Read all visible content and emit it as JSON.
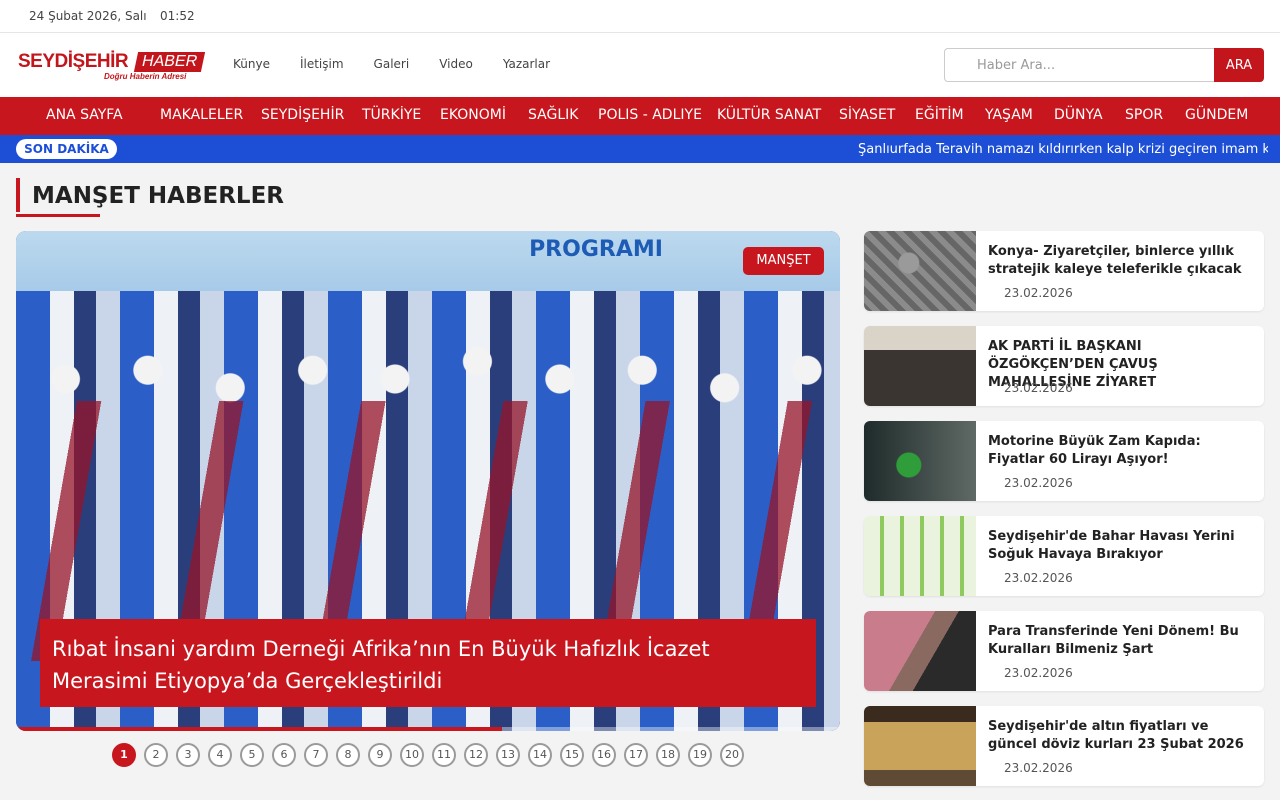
{
  "topbar": {
    "date": "24 Şubat 2026, Salı",
    "time": "01:52"
  },
  "logo": {
    "name": "SEYDİŞEHİR",
    "tag": "HABER",
    "slogan": "Doğru Haberin Adresi"
  },
  "topnav": [
    "Künye",
    "İletişim",
    "Galeri",
    "Video",
    "Yazarlar"
  ],
  "search": {
    "placeholder": "Haber Ara...",
    "button": "ARA"
  },
  "mainnav": [
    "ANA SAYFA",
    "MAKALELER",
    "SEYDİŞEHİR",
    "TÜRKİYE",
    "EKONOMİ",
    "SAĞLIK",
    "POLIS - ADLIYE",
    "KÜLTÜR SANAT",
    "SİYASET",
    "EĞİTİM",
    "YAŞAM",
    "DÜNYA",
    "SPOR",
    "GÜNDEM"
  ],
  "breaking": {
    "label": "SON DAKİKA",
    "text": "Şanlıurfada Teravih namazı kıldırırken kalp krizi geçiren imam kurt"
  },
  "section": {
    "title": "MANŞET HABERLER"
  },
  "hero": {
    "banner": "PROGRAMI",
    "tag": "MANŞET",
    "title": "Rıbat İnsani yardım Derneği Afrika’nın En Büyük Hafızlık İcazet Merasimi Etiyopya’da Gerçekleştirildi",
    "progress": 0.59
  },
  "pager": {
    "pages": [
      "1",
      "2",
      "3",
      "4",
      "5",
      "6",
      "7",
      "8",
      "9",
      "10",
      "11",
      "12",
      "13",
      "14",
      "15",
      "16",
      "17",
      "18",
      "19",
      "20"
    ],
    "active": 0
  },
  "side": [
    {
      "title": "Konya- Ziyaretçiler, binlerce yıllık stratejik kaleye teleferikle çıkacak",
      "date": "23.02.2026"
    },
    {
      "title": "AK PARTİ İL BAŞKANI ÖZGÖKÇEN’DEN ÇAVUŞ MAHALLESİNE ZİYARET",
      "date": "23.02.2026"
    },
    {
      "title": "Motorine Büyük Zam Kapıda: Fiyatlar 60 Lirayı Aşıyor!",
      "date": "23.02.2026"
    },
    {
      "title": "Seydişehir'de Bahar Havası Yerini Soğuk Havaya Bırakıyor",
      "date": "23.02.2026"
    },
    {
      "title": "Para Transferinde Yeni Dönem! Bu Kuralları Bilmeniz Şart",
      "date": "23.02.2026"
    },
    {
      "title": "Seydişehir'de altın fiyatları ve güncel döviz kurları 23 Şubat 2026",
      "date": "23.02.2026"
    }
  ]
}
